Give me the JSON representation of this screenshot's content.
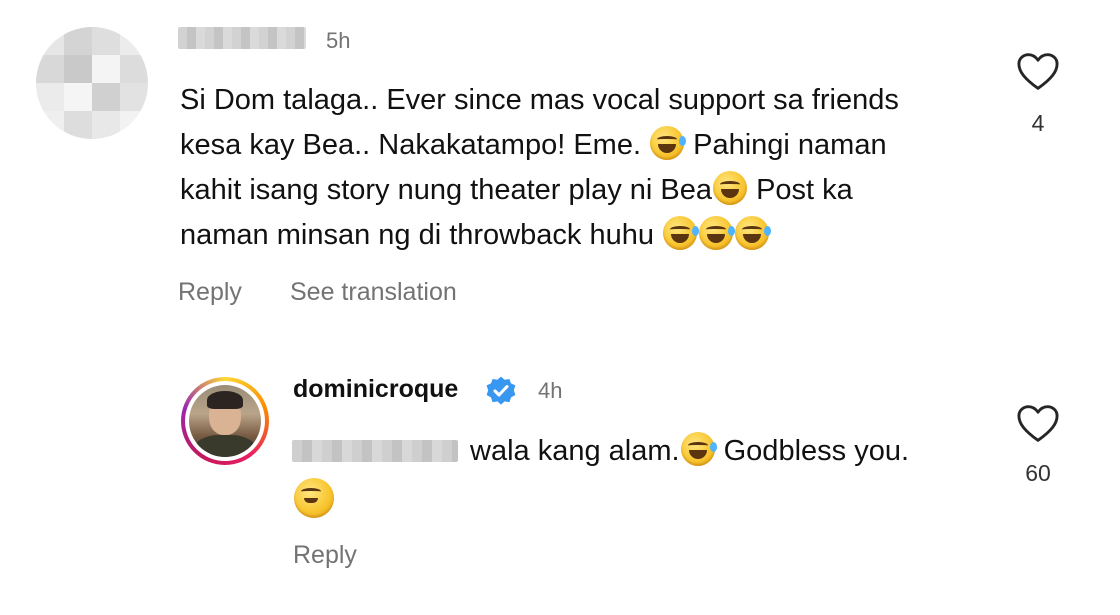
{
  "comment": {
    "time": "5h",
    "lines": [
      "Si Dom talaga.. Ever since mas vocal support sa friends",
      "kesa kay Bea.. Nakakatampo! Eme.",
      "Pahingi naman",
      "kahit isang story nung theater play ni Bea",
      "Post ka",
      "naman minsan ng di throwback huhu"
    ],
    "like_count": "4",
    "reply_label": "Reply",
    "translate_label": "See translation"
  },
  "reply": {
    "username": "dominicroque",
    "time": "4h",
    "text_a": "wala kang alam.",
    "text_b": "Godbless you.",
    "like_count": "60",
    "reply_label": "Reply"
  },
  "icons": {
    "heart": "heart-outline-icon",
    "verified": "verified-badge-icon",
    "emoji_joy": "face-with-tears-of-joy",
    "emoji_grin": "grinning-face-with-smiling-eyes",
    "emoji_sweat": "grinning-face-with-sweat",
    "emoji_wink": "winking-face"
  },
  "colors": {
    "muted_text": "#737373",
    "verified_blue": "#3897f0"
  }
}
